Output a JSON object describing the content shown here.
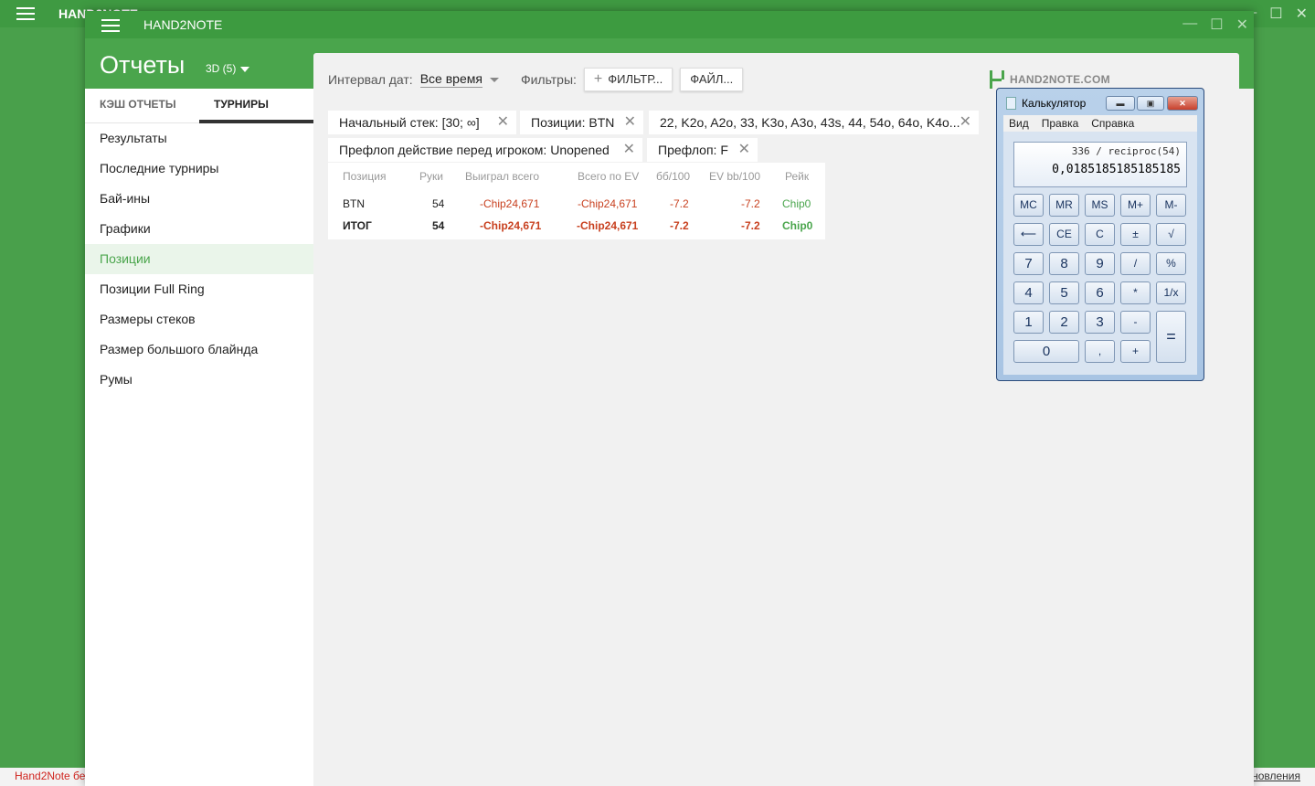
{
  "background_app": {
    "title": "HAND2NOTE",
    "status_left": "Hand2Note бе",
    "status_right": "новления"
  },
  "window": {
    "title": "HAND2NOTE",
    "controls": [
      "—",
      "☐",
      "✕"
    ]
  },
  "header": {
    "title": "Отчеты",
    "subtitle": "3D (5)"
  },
  "tabs": [
    {
      "label": "КЭШ ОТЧЕТЫ",
      "active": false
    },
    {
      "label": "ТУРНИРЫ",
      "active": true
    }
  ],
  "sidebar": {
    "items": [
      {
        "label": "Результаты",
        "active": false
      },
      {
        "label": "Последние турниры",
        "active": false
      },
      {
        "label": "Бай-ины",
        "active": false
      },
      {
        "label": "Графики",
        "active": false
      },
      {
        "label": "Позиции",
        "active": true
      },
      {
        "label": "Позиции Full Ring",
        "active": false
      },
      {
        "label": "Размеры стеков",
        "active": false
      },
      {
        "label": "Размер большого блайнда",
        "active": false
      },
      {
        "label": "Румы",
        "active": false
      }
    ]
  },
  "filter_bar": {
    "date_label": "Интервал дат:",
    "date_value": "Все время",
    "filters_label": "Фильтры:",
    "add_filter": "ФИЛЬТР...",
    "file_button": "ФАЙЛ..."
  },
  "chips": [
    "Начальный стек: [30; ∞]",
    "Позиции: BTN",
    "22, K2o, A2o, 33, K3o, A3o, 43s, 44, 54o, 64o, K4o...",
    "Префлоп действие перед игроком: Unopened",
    "Префлоп: F"
  ],
  "table": {
    "headers": [
      "Позиция",
      "Руки",
      "Выиграл всего",
      "Всего по EV",
      "бб/100",
      "EV bb/100",
      "Рейк"
    ],
    "rows": [
      [
        "BTN",
        "54",
        "-Chip24,671",
        "-Chip24,671",
        "-7.2",
        "-7.2",
        "Chip0"
      ],
      [
        "ИТОГ",
        "54",
        "-Chip24,671",
        "-Chip24,671",
        "-7.2",
        "-7.2",
        "Chip0"
      ]
    ]
  },
  "logo": {
    "text": "HAND2NOTE.COM"
  },
  "calculator": {
    "title": "Калькулятор",
    "menu": [
      "Вид",
      "Правка",
      "Справка"
    ],
    "expression": "336 / reciproc(54)",
    "value": "0,0185185185185185",
    "keys": [
      "MC",
      "MR",
      "MS",
      "M+",
      "M-",
      "⟵",
      "CE",
      "C",
      "±",
      "√",
      "7",
      "8",
      "9",
      "/",
      "%",
      "4",
      "5",
      "6",
      "*",
      "1/x",
      "1",
      "2",
      "3",
      "-",
      "=",
      "0",
      ",",
      "+"
    ]
  },
  "colors": {
    "brand_green": "#4aa54c",
    "negative_red": "#c8401f"
  }
}
